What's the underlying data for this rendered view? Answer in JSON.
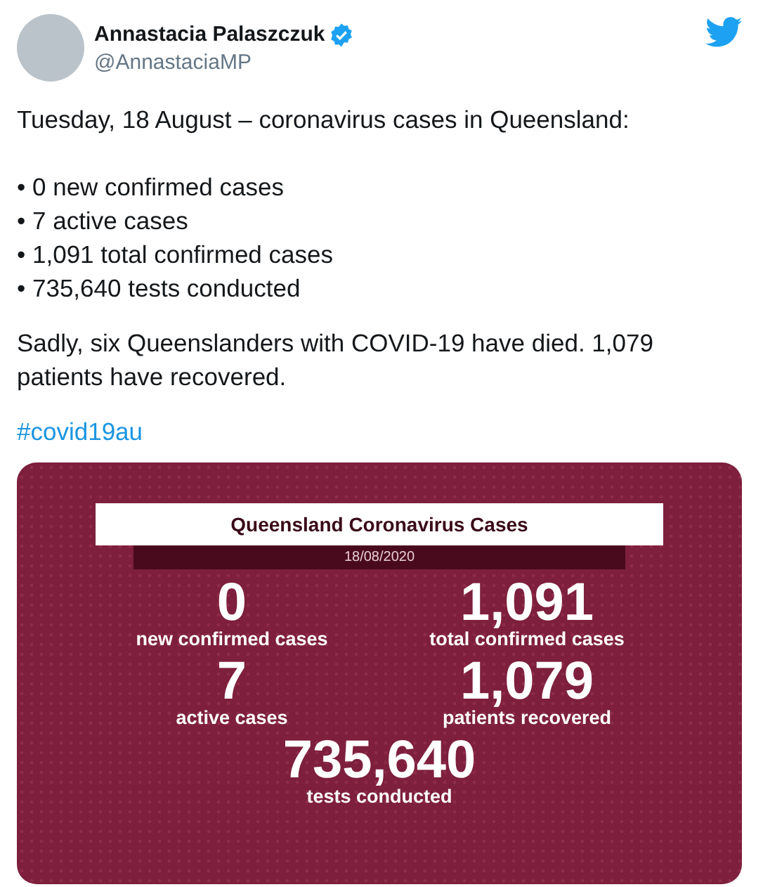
{
  "author": {
    "name": "Annastacia Palaszczuk",
    "verified": true,
    "handle": "@AnnastaciaMP"
  },
  "tweet": {
    "intro": "Tuesday, 18 August – coronavirus cases in Queensland:",
    "bullets": [
      "• 0 new confirmed cases",
      "• 7 active cases",
      "• 1,091 total confirmed cases",
      "• 735,640 tests conducted"
    ],
    "paragraph": "Sadly, six Queenslanders with COVID-19 have died. 1,079 patients have recovered.",
    "hashtag": "#covid19au"
  },
  "infographic": {
    "title": "Queensland Coronavirus Cases",
    "date": "18/08/2020",
    "stats": [
      {
        "value": "0",
        "label": "new confirmed cases"
      },
      {
        "value": "1,091",
        "label": "total confirmed cases"
      },
      {
        "value": "7",
        "label": "active cases"
      },
      {
        "value": "1,079",
        "label": "patients recovered"
      },
      {
        "value": "735,640",
        "label": "tests conducted"
      }
    ]
  }
}
